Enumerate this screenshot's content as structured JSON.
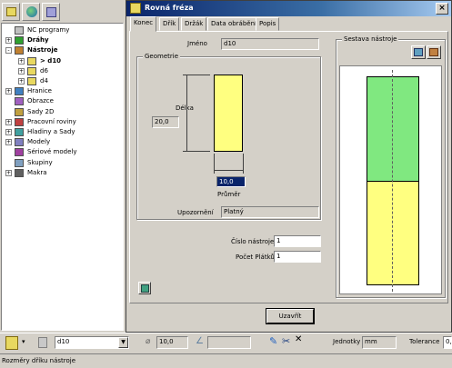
{
  "explorer": {
    "tree": [
      {
        "label": "NC programy",
        "bold": false,
        "expander": "",
        "indent": 0,
        "icon": "nc-programs-icon"
      },
      {
        "label": "Dráhy",
        "bold": true,
        "expander": "+",
        "indent": 0,
        "icon": "toolpaths-icon"
      },
      {
        "label": "Nástroje",
        "bold": true,
        "expander": "-",
        "indent": 0,
        "icon": "tools-icon"
      },
      {
        "label": "> d10",
        "bold": true,
        "expander": "+",
        "indent": 1,
        "icon": "tool-item-icon"
      },
      {
        "label": "d6",
        "bold": false,
        "expander": "+",
        "indent": 1,
        "icon": "tool-item-icon"
      },
      {
        "label": "d4",
        "bold": false,
        "expander": "+",
        "indent": 1,
        "icon": "tool-item-icon"
      },
      {
        "label": "Hranice",
        "bold": false,
        "expander": "+",
        "indent": 0,
        "icon": "boundaries-icon"
      },
      {
        "label": "Obrazce",
        "bold": false,
        "expander": "",
        "indent": 0,
        "icon": "patterns-icon"
      },
      {
        "label": "Sady 2D",
        "bold": false,
        "expander": "",
        "indent": 0,
        "icon": "sets-2d-icon"
      },
      {
        "label": "Pracovní roviny",
        "bold": false,
        "expander": "+",
        "indent": 0,
        "icon": "workplanes-icon"
      },
      {
        "label": "Hladiny a Sady",
        "bold": false,
        "expander": "+",
        "indent": 0,
        "icon": "levels-sets-icon"
      },
      {
        "label": "Modely",
        "bold": false,
        "expander": "+",
        "indent": 0,
        "icon": "models-icon"
      },
      {
        "label": "Sériové modely",
        "bold": false,
        "expander": "",
        "indent": 0,
        "icon": "stock-models-icon"
      },
      {
        "label": "Skupiny",
        "bold": false,
        "expander": "",
        "indent": 0,
        "icon": "groups-icon"
      },
      {
        "label": "Makra",
        "bold": false,
        "expander": "+",
        "indent": 0,
        "icon": "macros-icon"
      }
    ]
  },
  "dialog": {
    "title": "Rovná fréza",
    "close_label": "×",
    "tabs": [
      "Konec",
      "Dřík",
      "Držák",
      "Data obrábění",
      "Popis"
    ],
    "name_label": "Jméno",
    "name_value": "d10",
    "geometry_label": "Geometrie",
    "length_label": "Délka",
    "length_value": "20,0",
    "diameter_label": "Průměr",
    "diameter_value": "10,0",
    "warning_label": "Upozornění",
    "warning_value": "Platný",
    "tool_number_label": "Číslo nástroje",
    "tool_number_value": "1",
    "flutes_label": "Počet Plátků",
    "flutes_value": "1",
    "assembly_label": "Sestava nástroje",
    "close_button": "Uzavřít"
  },
  "bottom": {
    "tool_select": "d10",
    "diameter_value": "10,0",
    "units_label": "Jednotky",
    "units_value": "mm",
    "tolerance_label": "Tolerance",
    "tolerance_value": "0,"
  },
  "status": {
    "text": "Rozměry dříku nástroje"
  },
  "colors": {
    "tip_yellow": "#ffff80",
    "holder_green": "#80e880",
    "title_blue": "#0a246a"
  }
}
